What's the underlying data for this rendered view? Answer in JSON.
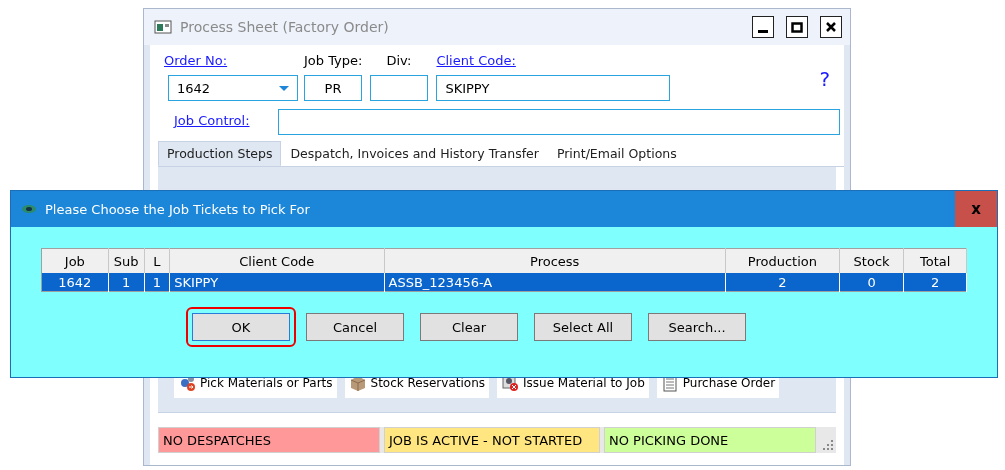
{
  "window": {
    "title": "Process Sheet (Factory Order)"
  },
  "form": {
    "order_no": {
      "label": "Order No:",
      "value": "1642"
    },
    "job_type": {
      "label": "Job Type:",
      "value": "PR"
    },
    "div": {
      "label": "Div:"
    },
    "client_code": {
      "label": "Client Code:",
      "value": "SKIPPY"
    },
    "help": "?",
    "job_control": {
      "label": "Job Control:"
    }
  },
  "tabs": [
    {
      "label": "Production Steps",
      "selected": true
    },
    {
      "label": "Despatch, Invoices and History Transfer",
      "selected": false
    },
    {
      "label": "Print/Email Options",
      "selected": false
    }
  ],
  "dialog": {
    "title": "Please Choose the Job Tickets to Pick For",
    "close": "x",
    "table": {
      "columns": [
        "Job",
        "Sub",
        "L",
        "Client Code",
        "Process",
        "Production",
        "Stock",
        "Total"
      ],
      "rows": [
        {
          "cells": [
            "1642",
            "1",
            "1",
            "SKIPPY",
            "ASSB_123456-A",
            "2",
            "0",
            "2"
          ],
          "selected": true
        }
      ]
    },
    "buttons": [
      {
        "label": "OK",
        "focused": true
      },
      {
        "label": "Cancel",
        "focused": false
      },
      {
        "label": "Clear",
        "focused": false
      },
      {
        "label": "Select All",
        "focused": false
      },
      {
        "label": "Search...",
        "focused": false
      }
    ]
  },
  "toolbar": [
    {
      "label": "Pick Materials or Parts",
      "kind": "gears"
    },
    {
      "label": "Stock Reservations",
      "kind": "box"
    },
    {
      "label": "Issue Material to Job",
      "kind": "issue"
    },
    {
      "label": "Purchase Order",
      "kind": "form"
    }
  ],
  "status_bar": [
    {
      "text": "NO DESPATCHES",
      "color": "#ff9999"
    },
    {
      "text": "JOB IS ACTIVE - NOT STARTED",
      "color": "#ffe680"
    },
    {
      "text": "NO PICKING DONE",
      "color": "#ccff99"
    }
  ]
}
